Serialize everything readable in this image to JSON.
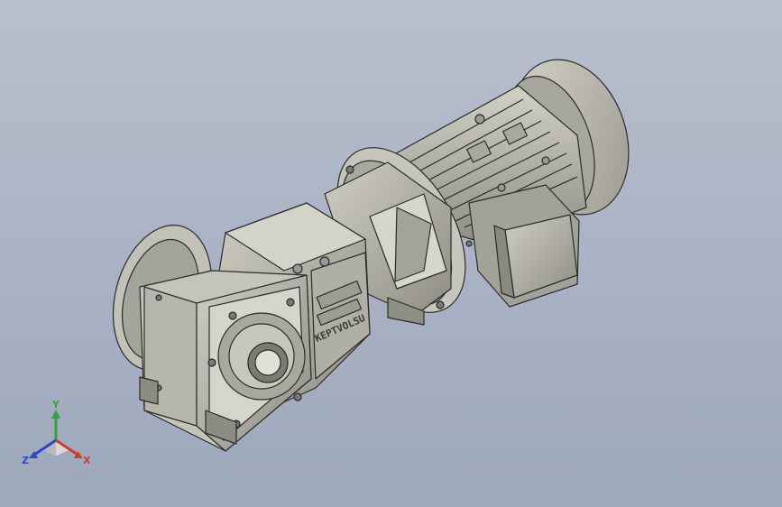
{
  "viewport": {
    "background_top": "#b8bfcd",
    "background_bottom": "#9ea8bb"
  },
  "model": {
    "body_color": "#b9b8ae",
    "shadow_color": "#6b6a63",
    "edge_color": "#2b2b2b",
    "casting_text": "KEPTVOLSU"
  },
  "triad": {
    "x_label": "X",
    "y_label": "Y",
    "z_label": "Z",
    "x_color": "#d23b2f",
    "y_color": "#3aa040",
    "z_color": "#3145c8"
  }
}
